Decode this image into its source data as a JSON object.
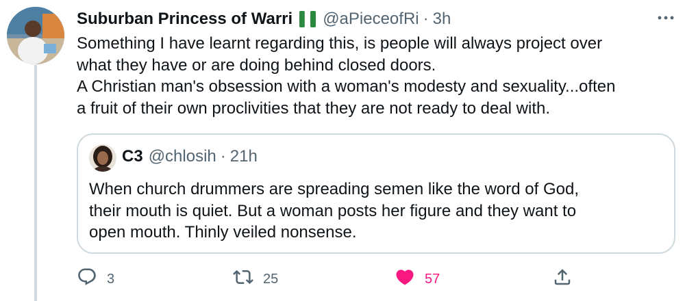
{
  "tweet": {
    "display_name": "Suburban Princess of Warri",
    "handle": "@aPieceofRi",
    "separator": "·",
    "time": "3h",
    "text_lines": [
      "Something I have learnt regarding this, is people will always project over",
      "what they have or are doing behind closed doors.",
      "A Christian man's obsession with a woman's modesty and sexuality...often",
      "a fruit of their own proclivities that they are not ready to deal with."
    ],
    "flag_icon": "nigeria-flag-icon"
  },
  "quote": {
    "display_name": "C3",
    "handle": "@chlosih",
    "separator": "·",
    "time": "21h",
    "text_lines": [
      "When church drummers are spreading semen like the word of God,",
      "their mouth is quiet. But a woman posts her figure and they want to",
      "open mouth. Thinly veiled nonsense."
    ]
  },
  "actions": {
    "reply_count": "3",
    "retweet_count": "25",
    "like_count": "57"
  },
  "colors": {
    "text": "#0f1419",
    "secondary": "#536471",
    "like": "#f91880",
    "border": "#cfd9de"
  }
}
